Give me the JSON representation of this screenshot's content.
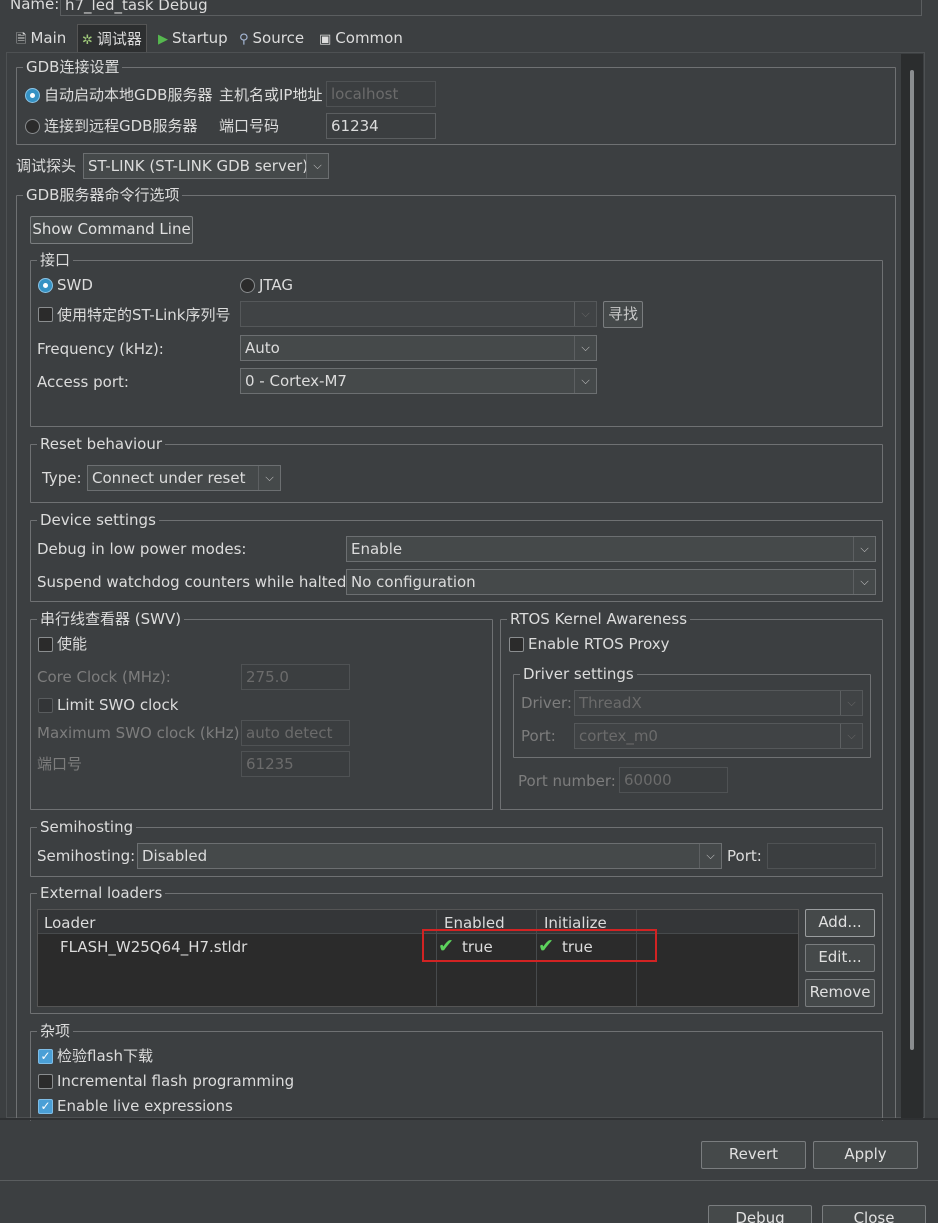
{
  "header": {
    "name_label": "Name:",
    "name_value": "h7_led_task Debug"
  },
  "tabs": [
    {
      "label": "Main",
      "icon": "document-icon"
    },
    {
      "label": "调试器",
      "icon": "debugger-icon"
    },
    {
      "label": "Startup",
      "icon": "play-icon"
    },
    {
      "label": "Source",
      "icon": "source-icon"
    },
    {
      "label": "Common",
      "icon": "common-icon"
    }
  ],
  "gdb": {
    "legend": "GDB连接设置",
    "auto_local": "自动启动本地GDB服务器",
    "connect_remote": "连接到远程GDB服务器",
    "host_label": "主机名或IP地址",
    "host_value": "localhost",
    "port_label": "端口号码",
    "port_value": "61234"
  },
  "probe": {
    "label": "调试探头",
    "value": "ST-LINK (ST-LINK GDB server)"
  },
  "server_opts": {
    "legend": "GDB服务器命令行选项",
    "show_cmd": "Show Command Line"
  },
  "interface": {
    "legend": "接口",
    "swd": "SWD",
    "jtag": "JTAG",
    "serial_label": "使用特定的ST-Link序列号",
    "serial_value": "",
    "find_button": "寻找",
    "freq_label": "Frequency (kHz):",
    "freq_value": "Auto",
    "ap_label": "Access port:",
    "ap_value": "0 - Cortex-M7"
  },
  "reset": {
    "legend": "Reset behaviour",
    "type_label": "Type:",
    "type_value": "Connect under reset"
  },
  "device": {
    "legend": "Device settings",
    "lowpower_label": "Debug in low power modes:",
    "lowpower_value": "Enable",
    "watchdog_label": "Suspend watchdog counters while halted:",
    "watchdog_value": "No configuration"
  },
  "swv": {
    "legend": "串行线查看器 (SWV)",
    "enable": "使能",
    "core_clock_label": "Core Clock (MHz):",
    "core_clock_value": "275.0",
    "limit_swo": "Limit SWO clock",
    "max_swo_label": "Maximum SWO clock (kHz):",
    "max_swo_value": "auto detect",
    "port_label": "端口号",
    "port_value": "61235"
  },
  "rtos": {
    "legend": "RTOS Kernel Awareness",
    "proxy": "Enable RTOS Proxy",
    "driver_legend": "Driver settings",
    "driver_label": "Driver:",
    "driver_value": "ThreadX",
    "port_label": "Port:",
    "port_value": "cortex_m0",
    "portnum_label": "Port number:",
    "portnum_value": "60000"
  },
  "semihosting": {
    "legend": "Semihosting",
    "label": "Semihosting:",
    "value": "Disabled",
    "port_label": "Port:",
    "port_value": ""
  },
  "loaders": {
    "legend": "External loaders",
    "headers": [
      "Loader",
      "Enabled",
      "Initialize"
    ],
    "rows": [
      {
        "loader": "FLASH_W25Q64_H7.stldr",
        "enabled": "true",
        "initialize": "true"
      }
    ],
    "add": "Add...",
    "edit": "Edit...",
    "remove": "Remove"
  },
  "misc": {
    "legend": "杂项",
    "verify": "检验flash下载",
    "incremental": "Incremental flash programming",
    "live": "Enable live expressions"
  },
  "footer": {
    "revert": "Revert",
    "apply": "Apply",
    "debug": "Debug",
    "close": "Close"
  },
  "colors": {
    "highlight_box": "#d22323",
    "check_green": "#5cd15c",
    "accent": "#3592c4"
  }
}
